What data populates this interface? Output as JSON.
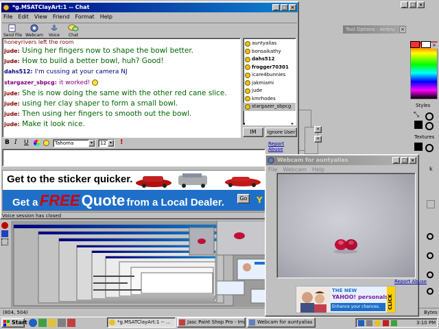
{
  "chat_window": {
    "title": "*g.MSATClayArt:1 -- Chat",
    "menu": [
      "File",
      "Edit",
      "View",
      "Friend",
      "Format",
      "Help"
    ],
    "toolbar": [
      "Send File",
      "Webcam",
      "Voice",
      "Chat"
    ],
    "messages": [
      {
        "nick": "",
        "text": "honeyrivers left the room",
        "style": "sys"
      },
      {
        "nick": "jude:",
        "text": "Using her fingers now to shape the bowl better.",
        "style": "green"
      },
      {
        "nick": "jude:",
        "text": "How to build a better bowl, huh? Good!",
        "style": "green"
      },
      {
        "nick": "dahs512:",
        "text": "I'm cussing at your camera NJ",
        "style": "blue"
      },
      {
        "nick": "stargazer_sbpcg:",
        "text": "it worked!",
        "style": "purple"
      },
      {
        "nick": "jude:",
        "text": "She is now doing the same with the other red cane slice.",
        "style": "green"
      },
      {
        "nick": "jude:",
        "text": "using her clay shaper to form a small bowl.",
        "style": "green"
      },
      {
        "nick": "jude:",
        "text": "Then using her fingers to smooth out the bowl.",
        "style": "green"
      },
      {
        "nick": "jude:",
        "text": "Make it look nice.",
        "style": "green"
      }
    ],
    "users": [
      "auntyalias",
      "bonsaikathy",
      "dahs512",
      "frogger70301",
      "icare4bunnies",
      "jakmiami",
      "jude",
      "kmrhodes",
      "stargazer_sbpcg"
    ],
    "bold_users": [
      "dahs512",
      "frogger70301"
    ],
    "selected_user": "stargazer_sbpcg",
    "im_button": "IM",
    "ignore_button": "Ignore User",
    "format": {
      "bold": "B",
      "italic": "I",
      "underline": "U",
      "font": "Tahoma",
      "size": "12"
    },
    "report_abuse": "Report Abuse",
    "ad": {
      "headline": "Get to the sticker quicker.",
      "line2_prefix": "Get a",
      "line2_free": "FREE",
      "line2_quote": "Quote",
      "line2_suffix": "from a Local Dealer.",
      "go": "Go",
      "brand": "Y"
    },
    "status": "Voice session has closed"
  },
  "webcam_window": {
    "title": "Webcam for auntyalias",
    "menu": [
      "File",
      "Webcam",
      "Help"
    ],
    "report_abuse": "Report Abuse",
    "ad": {
      "the_new": "THE NEW",
      "brand": "YAHOO! personals",
      "tagline": "Enhance your chances.",
      "click": "CLICK"
    }
  },
  "psp": {
    "tool_options": "Tool Options - Airbru",
    "styles": "Styles",
    "textures": "Textures",
    "lock_letter": "k",
    "coords": "(804, 504)",
    "bytes": "Bytes"
  },
  "taskbar": {
    "start": "Start",
    "tasks": [
      "*g.MSATClayArt:1 -- ...",
      "Jasc Paint Shop Pro - Ima...",
      "Webcam for auntyalias"
    ],
    "clock": "3:10 PM"
  },
  "colors": {
    "title_active": "#000080",
    "chat_green": "#006600",
    "nick_red": "#800000",
    "nick_blue": "#000080",
    "nick_purple": "#800080",
    "ad_blue": "#1f6fc9",
    "ad_red": "#d40000",
    "webcam_bg": "#b8b8c0",
    "clay_red": "#c0103a"
  }
}
